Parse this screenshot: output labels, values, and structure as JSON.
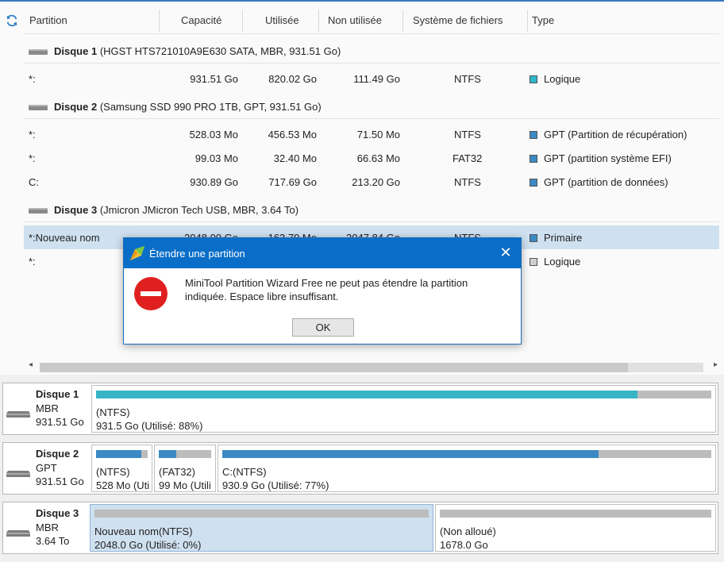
{
  "table": {
    "headers": {
      "partition": "Partition",
      "capacity": "Capacité",
      "used": "Utilisée",
      "unused": "Non utilisée",
      "fs": "Système de fichiers",
      "type": "Type"
    },
    "disks": [
      {
        "name": "Disque 1",
        "details": "(HGST HTS721010A9E630 SATA, MBR, 931.51 Go)",
        "rows": [
          {
            "partition": "*:",
            "capacity": "931.51 Go",
            "used": "820.02 Go",
            "unused": "111.49 Go",
            "fs": "NTFS",
            "type": "Logique",
            "type_color": "#2fb6c9"
          }
        ]
      },
      {
        "name": "Disque 2",
        "details": "(Samsung SSD 990 PRO 1TB, GPT, 931.51 Go)",
        "rows": [
          {
            "partition": "*:",
            "capacity": "528.03 Mo",
            "used": "456.53 Mo",
            "unused": "71.50 Mo",
            "fs": "NTFS",
            "type": "GPT (Partition de récupération)",
            "type_color": "#3b8ac4"
          },
          {
            "partition": "*:",
            "capacity": "99.03 Mo",
            "used": "32.40 Mo",
            "unused": "66.63 Mo",
            "fs": "FAT32",
            "type": "GPT (partition système EFI)",
            "type_color": "#3b8ac4"
          },
          {
            "partition": "C:",
            "capacity": "930.89 Go",
            "used": "717.69 Go",
            "unused": "213.20 Go",
            "fs": "NTFS",
            "type": "GPT (partition de données)",
            "type_color": "#3b8ac4"
          }
        ]
      },
      {
        "name": "Disque 3",
        "details": "(Jmicron JMicron Tech USB, MBR, 3.64 To)",
        "rows": [
          {
            "partition": "*:Nouveau nom",
            "capacity": "2048.00 Go",
            "used": "163.79 Mo",
            "unused": "2047.84 Go",
            "fs": "NTFS",
            "type": "Primaire",
            "type_color": "#3b8ac4",
            "selected": true
          },
          {
            "partition": "*:",
            "capacity": "",
            "used": "",
            "unused": "",
            "fs": "",
            "type": "Logique",
            "type_color": "#cfcfcf"
          }
        ]
      }
    ]
  },
  "diskmap": [
    {
      "name": "Disque 1",
      "scheme": "MBR",
      "size": "931.51 Go",
      "partitions": [
        {
          "label": "(NTFS)",
          "detail": "931.5 Go (Utilisé: 88%)",
          "used_pct": 88,
          "color": "#38b4c6"
        }
      ]
    },
    {
      "name": "Disque 2",
      "scheme": "GPT",
      "size": "931.51 Go",
      "partitions": [
        {
          "label": "(NTFS)",
          "detail": "528 Mo (Uti",
          "used_pct": 87,
          "color": "#3b8ac4"
        },
        {
          "label": "(FAT32)",
          "detail": "99 Mo (Utili",
          "used_pct": 33,
          "color": "#3b8ac4"
        },
        {
          "label": "C:(NTFS)",
          "detail": "930.9 Go (Utilisé: 77%)",
          "used_pct": 77,
          "color": "#3b8ac4"
        }
      ]
    },
    {
      "name": "Disque 3",
      "scheme": "MBR",
      "size": "3.64 To",
      "partitions": [
        {
          "label": "Nouveau nom(NTFS)",
          "detail": "2048.0 Go (Utilisé: 0%)",
          "used_pct": 0,
          "color": "#3b8ac4",
          "selected": true
        },
        {
          "label": "(Non alloué)",
          "detail": "1678.0 Go",
          "used_pct": 0,
          "color": "#bcbcbc"
        }
      ]
    }
  ],
  "dialog": {
    "title": "Étendre une partition",
    "message": "MiniTool Partition Wizard Free ne peut pas étendre la partition indiquée. Espace libre insuffisant.",
    "ok": "OK",
    "close_glyph": "✕"
  },
  "colors": {
    "accent": "#0a6ec8",
    "selection": "#cfe0f0",
    "error": "#e02020"
  }
}
